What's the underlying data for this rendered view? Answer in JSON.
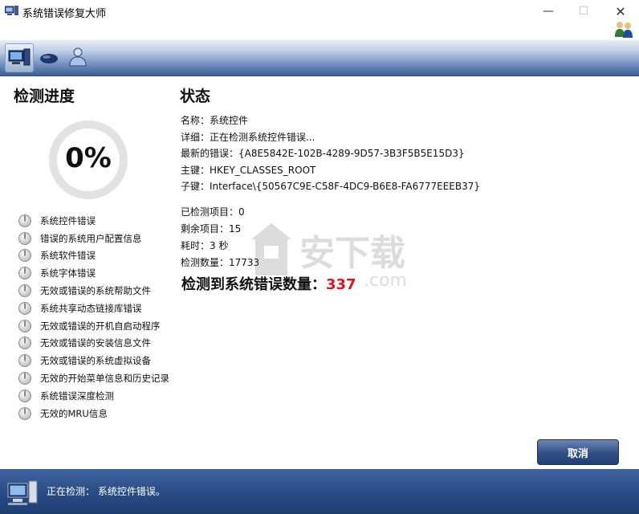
{
  "window": {
    "title": "系统错误修复大师",
    "controls": {
      "minimize": "—",
      "maximize": "☐",
      "close": "✕"
    }
  },
  "toolbar": {
    "buttons": [
      {
        "icon": "computer-icon",
        "active": true
      },
      {
        "icon": "mouse-icon",
        "active": false
      },
      {
        "icon": "user-icon",
        "active": false
      }
    ]
  },
  "progress_panel": {
    "heading": "检测进度",
    "percent": "0%",
    "progress_value": 0,
    "items": [
      "系统控件错误",
      "错误的系统用户配置信息",
      "系统软件错误",
      "系统字体错误",
      "无效或错误的系统帮助文件",
      "系统共享动态链接库错误",
      "无效或错误的开机自启动程序",
      "无效或错误的安装信息文件",
      "无效或错误的系统虚拟设备",
      "无效的开始菜单信息和历史记录",
      "系统错误深度检测",
      "无效的MRU信息"
    ]
  },
  "status_panel": {
    "heading": "状态",
    "name": "名称：系统控件",
    "detail": "详细：正在检测系统控件错误...",
    "latest_error": "最新的错误：{A8E5842E-102B-4289-9D57-3B3F5B5E15D3}",
    "main_key": "主键：HKEY_CLASSES_ROOT",
    "sub_key": "子键：Interface\\{50567C9E-C58F-4DC9-B6E8-FA6777EEEB37}",
    "checked_items": "已检测项目：0",
    "remaining_items": "剩余项目：15",
    "elapsed": "耗时：3 秒",
    "scan_count": "检测数量：17733",
    "summary_label": "检测到系统错误数量：",
    "summary_count": "337"
  },
  "watermark": {
    "text": "安下载",
    "subtext": ".com"
  },
  "buttons": {
    "cancel": "取消"
  },
  "footer": {
    "status_text": "正在检测： 系统控件错误。"
  },
  "colors": {
    "toolbar_blue": "#3d5f97",
    "footer_blue": "#2c4f88",
    "error_count_red": "#e0141e",
    "ring_gray": "#e2e2e2"
  }
}
